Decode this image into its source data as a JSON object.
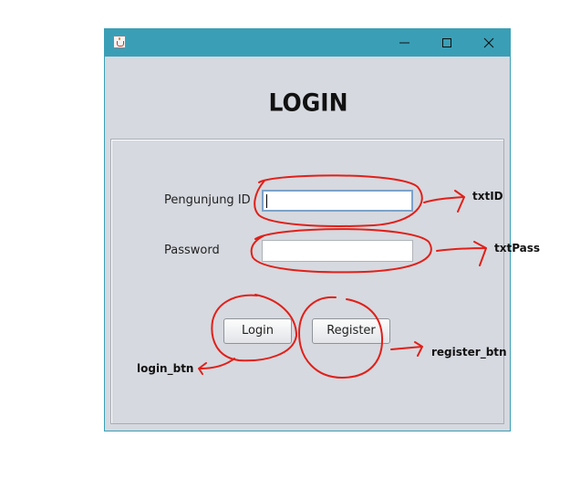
{
  "window": {
    "title_icon": "java-icon",
    "controls": [
      "minimize-icon",
      "maximize-icon",
      "close-icon"
    ]
  },
  "form": {
    "title": "LOGIN",
    "id_label": "Pengunjung ID",
    "password_label": "Password",
    "id_value": "",
    "password_value": "",
    "login_label": "Login",
    "register_label": "Register"
  },
  "annotations": {
    "txt_id": "txtID",
    "txt_pass": "txtPass",
    "login_btn": "login_btn",
    "register_btn": "register_btn",
    "color": "#e0201a"
  }
}
